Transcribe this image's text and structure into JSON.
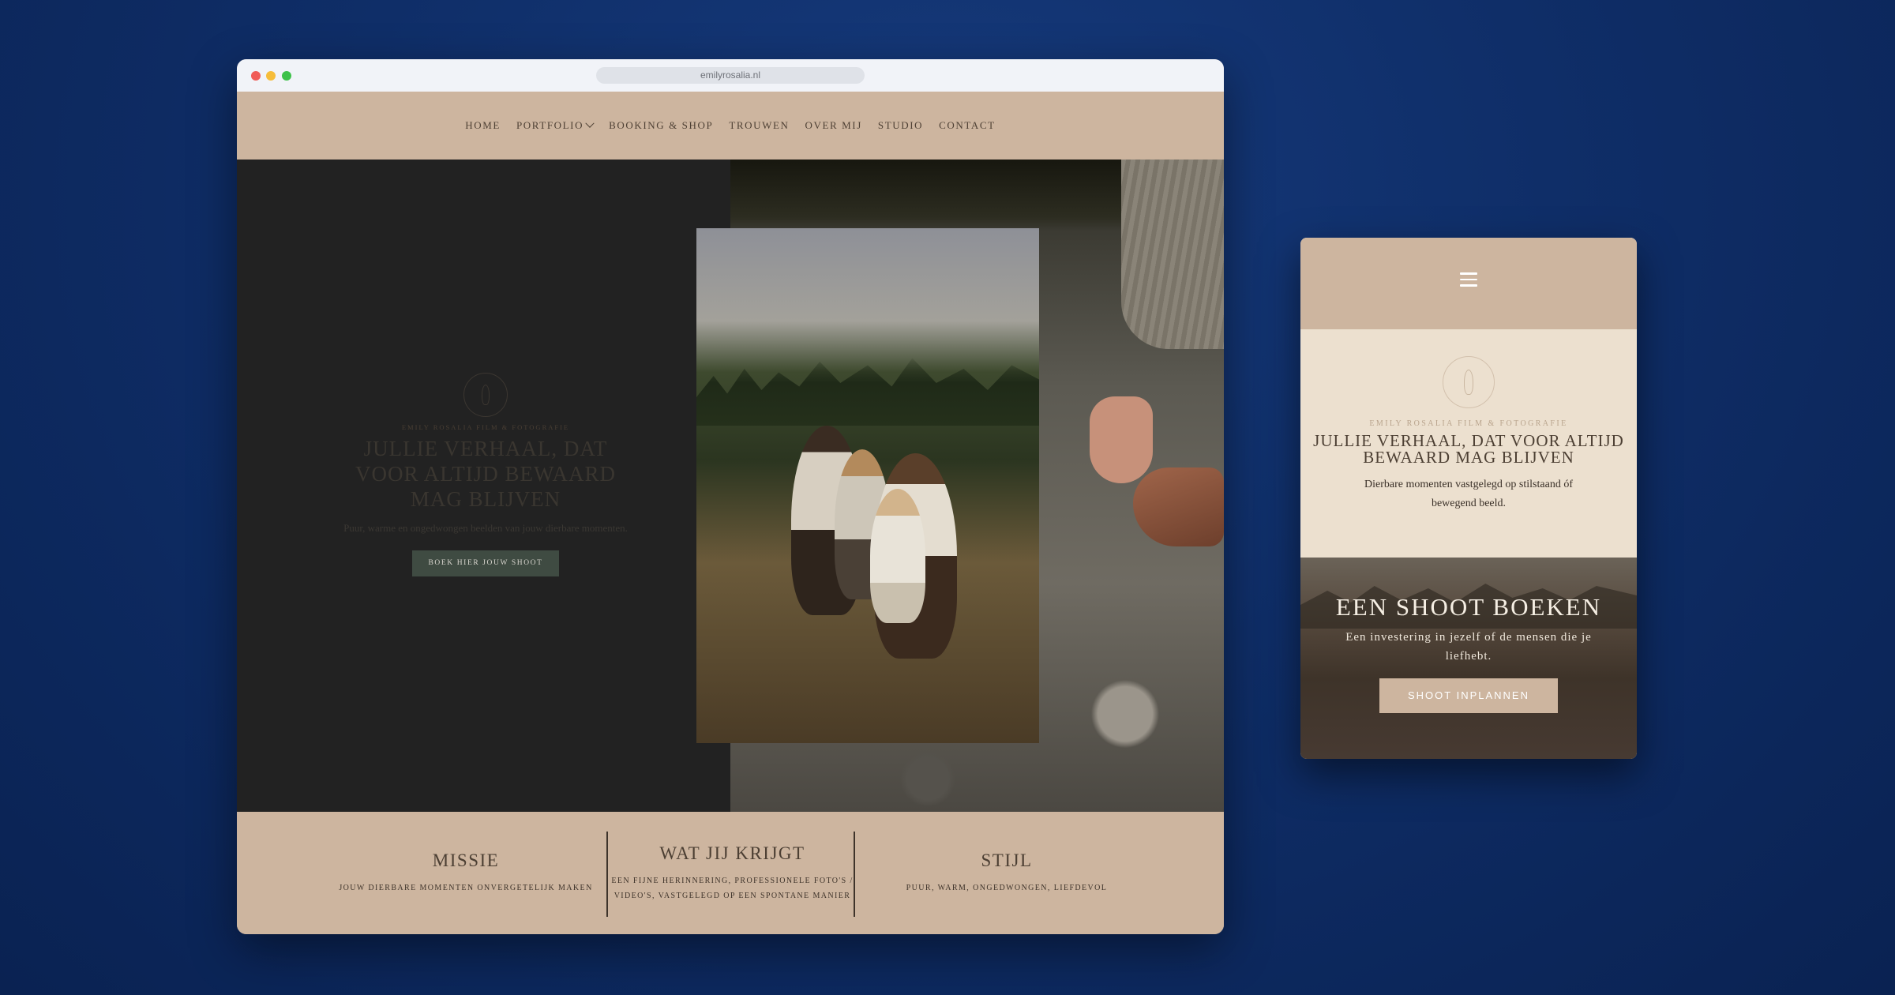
{
  "browser": {
    "url": "emilyrosalia.nl"
  },
  "nav": {
    "items": [
      {
        "label": "HOME"
      },
      {
        "label": "PORTFOLIO"
      },
      {
        "label": "BOOKING & SHOP"
      },
      {
        "label": "TROUWEN"
      },
      {
        "label": "OVER MIJ"
      },
      {
        "label": "STUDIO"
      },
      {
        "label": "CONTACT"
      }
    ]
  },
  "hero": {
    "brand": "EMILY ROSALIA FILM & FOTOGRAFIE",
    "title": "JULLIE VERHAAL, DAT VOOR ALTIJD BEWAARD MAG BLIJVEN",
    "subtitle": "Puur, warme en ongedwongen beelden van jouw dierbare momenten.",
    "button": "BOEK HIER JOUW SHOOT"
  },
  "features": [
    {
      "title": "MISSIE",
      "desc": "JOUW DIERBARE MOMENTEN ONVERGETELIJK MAKEN"
    },
    {
      "title": "WAT JIJ KRIJGT",
      "desc": "EEN FIJNE HERINNERING, PROFESSIONELE FOTO'S / VIDEO'S, VASTGELEGD OP EEN SPONTANE MANIER"
    },
    {
      "title": "STIJL",
      "desc": "PUUR, WARM, ONGEDWONGEN, LIEFDEVOL"
    }
  ],
  "mobile": {
    "brand": "EMILY ROSALIA FILM & FOTOGRAFIE",
    "title": "JULLIE VERHAAL, DAT VOOR ALTIJD BEWAARD MAG BLIJVEN",
    "subtitle": "Dierbare momenten vastgelegd op stilstaand óf bewegend beeld.",
    "booking_title": "EEN SHOOT BOEKEN",
    "booking_subtitle": "Een investering in jezelf of de mensen die je liefhebt.",
    "booking_button": "SHOOT INPLANNEN"
  },
  "icons": {
    "menu": "hamburger-menu-icon",
    "dropdown": "chevron-down-icon",
    "logo": "rose-logo-icon"
  },
  "colors": {
    "background": "#0f2e68",
    "tan": "#cdb59f",
    "cream": "#ece0cf",
    "dark": "#222222",
    "button_green": "#3f4b42"
  }
}
